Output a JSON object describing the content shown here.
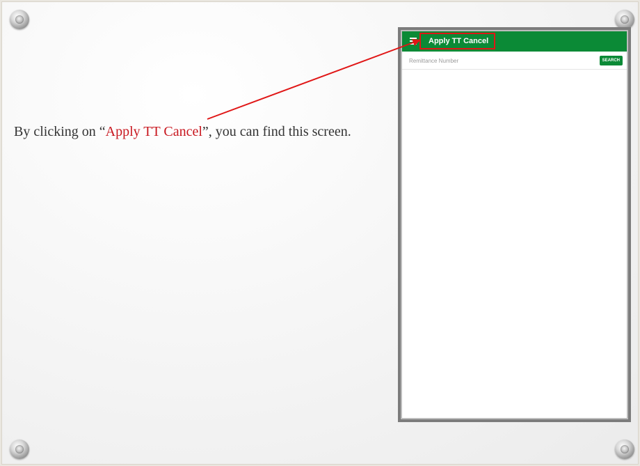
{
  "caption": {
    "before": "By clicking on “",
    "highlight": "Apply TT Cancel",
    "after": "”, you can find this screen."
  },
  "app": {
    "title": "Apply TT Cancel",
    "menu_icon": "hamburger-menu-icon",
    "search": {
      "placeholder": "Remittance Number",
      "button_label": "SEARCH"
    }
  },
  "colors": {
    "app_bar": "#0b8a36",
    "highlight": "#c8171f",
    "annotation": "#e01616"
  }
}
